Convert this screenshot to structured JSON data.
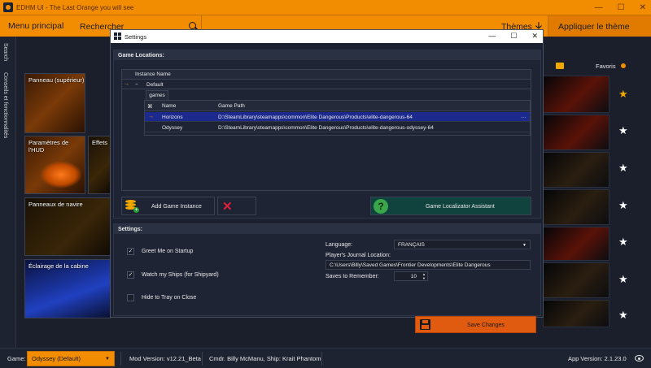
{
  "window": {
    "title": "EDHM UI - The Last Orange you will see",
    "minimize": "—",
    "maximize": "☐",
    "close": "✕"
  },
  "menubar": {
    "main_menu": "Menu principal",
    "search": "Rechercher",
    "themes": "Thèmes",
    "themes_arrow": "🡣",
    "apply_theme": "Appliquer le thème"
  },
  "sidebar": {
    "tabs": [
      "Search",
      "Conseils et fonctionnalités"
    ]
  },
  "tiles": {
    "upper_panel": "Panneau (supérieur)",
    "hud_settings": "Paramètres de l'HUD",
    "effects": "Effets",
    "ship_panels": "Panneaux de navire",
    "cabin_lighting": "Éclairage de la cabine"
  },
  "favorites": {
    "label": "Favoris",
    "stars": [
      "★",
      "★",
      "★",
      "★",
      "★",
      "★",
      "★"
    ],
    "first_starred_color": "#f2a800"
  },
  "status": {
    "game_label": "Game:",
    "game_value": "Odyssey (Default)",
    "mod_version": "Mod Version: v12.21_Beta",
    "commander": "Cmdr. Billy McManu, Ship: Krait Phantom",
    "app_version": "App Version: 2.1.23.0"
  },
  "dialog": {
    "title": "Settings",
    "minimize": "—",
    "maximize": "☐",
    "close": "✕",
    "game_locations": {
      "header": "Game Locations:",
      "column_instance_name": "Instance Name",
      "default_row": "Default",
      "collapse_symbol": "−",
      "tab_games": "games",
      "columns": [
        "Name",
        "Game Path"
      ],
      "rows": [
        {
          "name": "Horizons",
          "path": "D:\\SteamLibrary\\steamapps\\common\\Elite Dangerous\\Products\\elite-dangerous-64",
          "selected": true
        },
        {
          "name": "Odyssey",
          "path": "D:\\SteamLibrary\\steamapps\\common\\Elite Dangerous\\Products\\elite-dangerous-odyssey-64",
          "selected": false
        }
      ],
      "add_instance": "Add Game Instance",
      "game_localizator": "Game Localizator Assistant"
    },
    "settings": {
      "header": "Settings:",
      "greet_me": "Greet Me on Startup",
      "greet_me_checked": true,
      "watch_ships": "Watch my Ships (for Shipyard)",
      "watch_ships_checked": true,
      "hide_tray": "Hide to Tray on Close",
      "hide_tray_checked": false,
      "language_label": "Language:",
      "language_value": "FRANÇAIS",
      "journal_label": "Player's Journal Location:",
      "journal_value": "C:\\Users\\Billy\\Saved Games\\Frontier Developments\\Elite Dangerous",
      "saves_label": "Saves to Remember:",
      "saves_value": "10"
    },
    "save_changes": "Save Changes"
  },
  "colors": {
    "accent_orange": "#f28c00",
    "save_button": "#e05a10",
    "selected_row": "#1b2a8c",
    "locator_button": "#10423e"
  }
}
